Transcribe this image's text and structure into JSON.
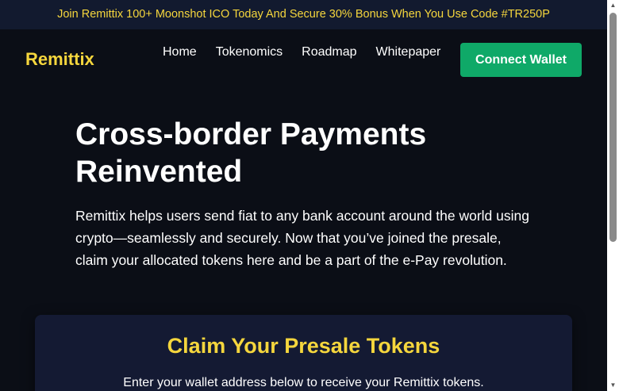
{
  "promo": {
    "text": "Join Remittix 100+ Moonshot ICO Today And Secure 30% Bonus When You Use Code #TR250P"
  },
  "nav": {
    "logo": "Remittix",
    "links": [
      "Home",
      "Tokenomics",
      "Roadmap",
      "Whitepaper"
    ],
    "connect_label": "Connect Wallet"
  },
  "hero": {
    "title_line1": "Cross-border Payments",
    "title_line2": "Reinvented",
    "description_line1": "Remittix helps users send fiat to any bank account around the world using",
    "description_line2": "crypto—seamlessly and securely. Now that you’ve joined the presale,",
    "description_line3": "claim your allocated tokens here and be a part of the e-Pay revolution."
  },
  "claim": {
    "title": "Claim Your Presale Tokens",
    "description": "Enter your wallet address below to receive your Remittix tokens."
  },
  "scrollbar": {
    "up_icon": "triangle-up-icon",
    "down_icon": "triangle-down-icon"
  },
  "colors": {
    "background": "#0b0e16",
    "promo_bg": "#121a2f",
    "accent_yellow": "#f5d63d",
    "button_green": "#0fa968",
    "card_bg": "#141a33"
  }
}
